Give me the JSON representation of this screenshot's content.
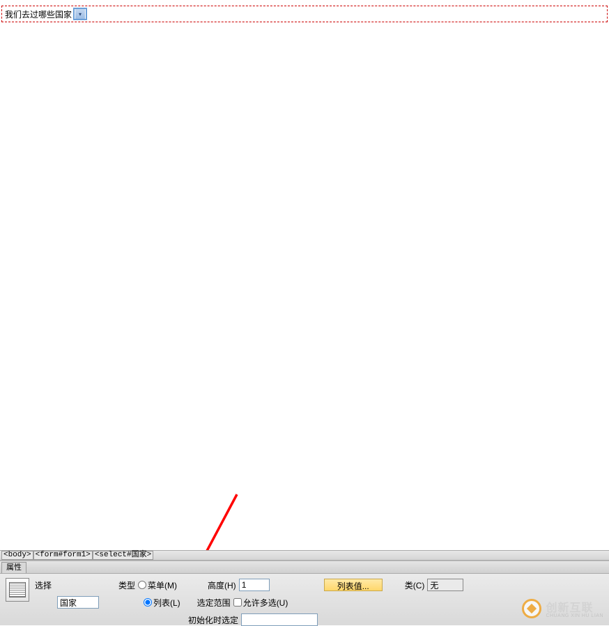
{
  "design": {
    "form_label": "我们去过哪些国家"
  },
  "tag_path": {
    "body": "<body>",
    "form": "<form#form1>",
    "select": "<select#国家>"
  },
  "properties": {
    "tab_title": "属性",
    "select_label": "选择",
    "name_value": "国家",
    "type_label": "类型",
    "type_menu": "菜单(M)",
    "type_list": "列表(L)",
    "height_label": "高度(H)",
    "height_value": "1",
    "range_label": "选定范围",
    "allow_multi": "允许多选(U)",
    "list_values_btn": "列表值...",
    "class_label": "类(C)",
    "class_value": "无",
    "init_label": "初始化时选定"
  },
  "watermark": {
    "main": "创新互联",
    "sub": "CHUANG XIN HU LIAN"
  }
}
